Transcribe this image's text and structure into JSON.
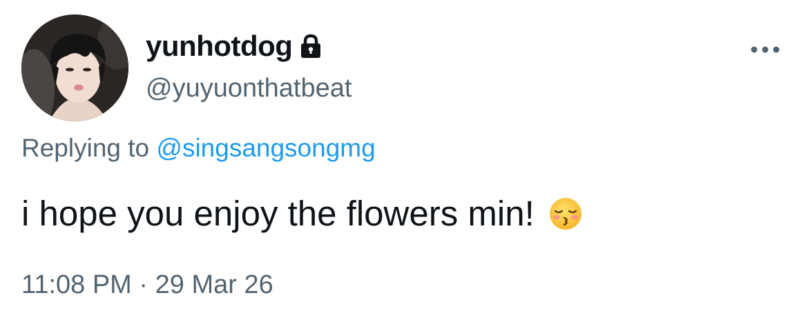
{
  "user": {
    "display_name": "yunhotdog",
    "handle": "@yuyuonthatbeat",
    "protected_icon": "lock-icon",
    "avatar_icon": "profile-photo"
  },
  "menu": {
    "icon": "more-horizontal-icon"
  },
  "reply": {
    "prefix": "Replying to",
    "to_handle": "@singsangsongmg"
  },
  "tweet": {
    "text": "i hope you enjoy the flowers min!",
    "emoji_icon": "kissing-face-with-closed-eyes-emoji"
  },
  "meta": {
    "time": "11:08 PM",
    "separator": "·",
    "date": "29 Mar 26"
  },
  "colors": {
    "primary_text": "#0f1419",
    "secondary_text": "#536471",
    "link": "#1d9bf0"
  }
}
